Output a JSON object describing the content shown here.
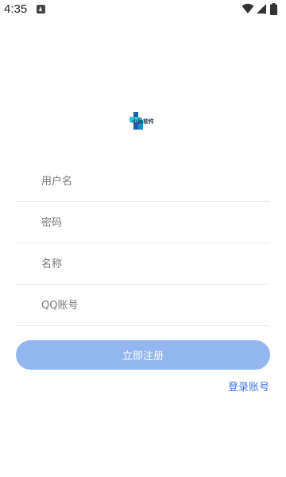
{
  "status_bar": {
    "time": "4:35",
    "icons": [
      "app-notification-icon",
      "wifi-icon",
      "signal-icon",
      "battery-icon"
    ]
  },
  "logo": {
    "text": "小贝软件",
    "colors": {
      "blue": "#1f5fa8",
      "cyan": "#2ec4d8",
      "dark": "#1a2a4a"
    }
  },
  "form": {
    "username_placeholder": "用户名",
    "password_placeholder": "密码",
    "name_placeholder": "名称",
    "qq_placeholder": "QQ账号"
  },
  "actions": {
    "register_label": "立即注册",
    "login_link_label": "登录账号"
  },
  "colors": {
    "button_bg": "#93b6ef",
    "link": "#3b78e7",
    "divider": "#ececec"
  }
}
